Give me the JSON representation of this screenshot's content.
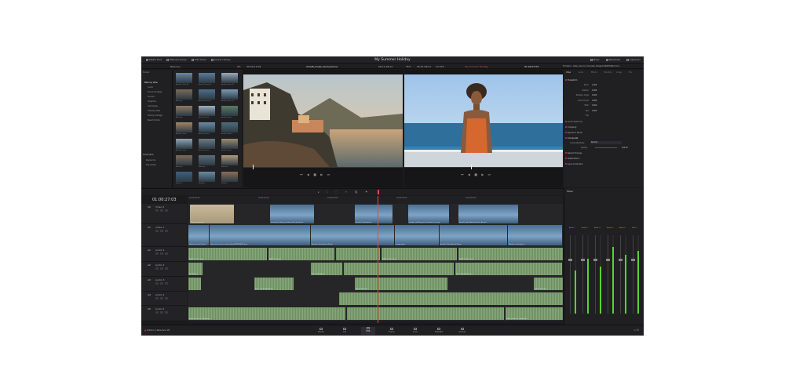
{
  "header": {
    "project_title": "My Summer Holiday",
    "nav": [
      "Media Pool",
      "Effects Library",
      "Edit Index",
      "Sound Library"
    ],
    "right_nav": [
      "Mixer",
      "Metadata",
      "Inspector"
    ]
  },
  "toolbar": {
    "bin_name": "Balcony...",
    "zoom": "9%",
    "source_tc": "00:00:11:09",
    "source_clip": "Amalfi_Coast_Aerial_Drone",
    "source_duration": "00:11:08:12",
    "zoom2": "45%",
    "record_tc": "00:01:08:11",
    "fps": "23.976",
    "timeline_name_red": "My Summer Holiday",
    "record_tc2": "01:00:27:03",
    "inspector_title": "Timeline - take_care_to_me_task_Integral PR2833J22.mov"
  },
  "bins": {
    "label": "Master",
    "items": [
      "Balcony View",
      "Audio",
      "Drone Footage",
      "Sunset",
      "Graphics",
      "Interviews",
      "Holiday Stills",
      "Family Footage",
      "Beach Shots"
    ],
    "smart_label": "Smart Bins",
    "smart_items": [
      "Keywords",
      "Favourites"
    ]
  },
  "thumbs": [
    "Amalfi_Coast_A...",
    "Amalfi_Coast_B...",
    "Amalfi_Coast_D...",
    "Balcony...",
    "Amalfi_Coast_E...",
    "Amalfi_Coast_H...",
    "Balcony...",
    "Amalfi_Coast...",
    "Amalfi_Coast...",
    "Amalfi_Coast...",
    "Amalfi_Coast...",
    "Amalfi_Coast...",
    "Amalfi_Coast...",
    "Amalfi_Coast...",
    "Amalfi_Coast...",
    "Balcony...",
    "Balcony...",
    "Balcony...",
    "Mediter...",
    "Mediter...",
    "Mediter..."
  ],
  "timecode": "01:00:27:03",
  "ruler": [
    "01:00:00:00",
    "01:00:10:00",
    "01:00:20:00",
    "01:00:30:00",
    "01:00:40:00"
  ],
  "tracks": [
    {
      "id": "V2",
      "name": "Video 2"
    },
    {
      "id": "V1",
      "name": "Video 1"
    },
    {
      "id": "A1",
      "name": "Audio 1"
    },
    {
      "id": "A2",
      "name": "Audio 2"
    },
    {
      "id": "A3",
      "name": "Audio 3"
    },
    {
      "id": "A4",
      "name": "Audio 4"
    },
    {
      "id": "A5",
      "name": "Audio 5"
    }
  ],
  "clips": {
    "v2": [
      "Close up woman...",
      "mountain_along_to_lake_aerial_by_drone...",
      "Amalfi_Coast_Aerial...",
      "people_strolling_on_the_beach_to_stay...",
      "Amalfi_Coast_Aerial_Drone_Arrival..."
    ],
    "v1": [
      "Balcony_Coast_Scen...",
      "take_care_to_me_task_Integral PR2833J22.mov",
      "Amalfi_Coast_Aerial_Drone",
      "people_pan...",
      "Amalfi_Coast_Aerial_Drone",
      "Woman_Leaving_to..."
    ],
    "audio": [
      "BMPCC_01_D.wav",
      "BMPCC_01.wav",
      "BMPCC_06_C.wav",
      "BMPCC_06_D.wav",
      "PR_28.wav",
      "SFX - Bird Wash...",
      "SFX - Bird Ambience",
      "SFX - Ocean Ambience",
      "Beach Surf.wav",
      "Beach Surf.wav",
      "Music Score for Trailer.wav",
      "Music Score for Trailer.wav"
    ]
  },
  "inspector": {
    "tabs": [
      "Video",
      "Audio",
      "Effects",
      "Transition",
      "Image",
      "File"
    ],
    "sections": [
      "Transform",
      "Cropping",
      "Dynamic Zoom",
      "Composite",
      "Speed Change",
      "Stabilization",
      "Lens Correction"
    ],
    "transform_labels": [
      "Zoom",
      "Position",
      "Rotation Angle",
      "Anchor Point",
      "Pitch",
      "Yaw",
      "Flip"
    ],
    "transform_values": [
      "1.000",
      "0.000",
      "0.000",
      "0.000",
      "0.000",
      "0.000",
      ""
    ],
    "composite_mode_label": "Composite Mode",
    "composite_mode": "Normal",
    "opacity_label": "Opacity",
    "opacity": "100.00",
    "smart_reframe": "Smart Reframe"
  },
  "mixer": {
    "title": "Mixer",
    "channels": [
      "Audio 1",
      "Audio 2",
      "Audio 3",
      "Audio 4",
      "Audio 5",
      "Main 1"
    ],
    "levels": [
      0.55,
      0.7,
      0.6,
      0.85,
      0.75,
      0.8
    ]
  },
  "pages": [
    "Media",
    "Cut",
    "Edit",
    "Fusion",
    "Color",
    "Fairlight",
    "Deliver"
  ],
  "active_page": "Edit",
  "brand": "DaVinci Resolve 18",
  "colors": {
    "accent": "#e64b3c",
    "video_clip": "#557aa8",
    "audio_clip": "#6d8f62",
    "meter": "#5bd032"
  }
}
